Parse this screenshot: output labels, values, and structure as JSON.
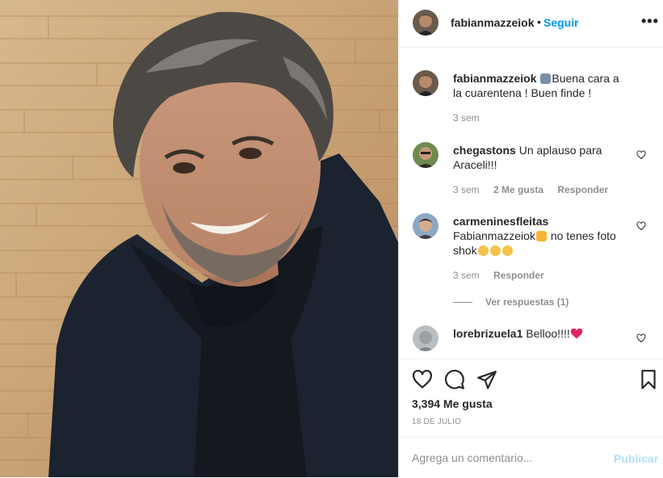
{
  "post": {
    "image_alt": "Fotografía de un hombre sonriente con abrigo oscuro frente a una pared de madera",
    "likes": "3,394 Me gusta",
    "date": "18 DE JULIO"
  },
  "header": {
    "username": "fabianmazzeiok",
    "dot": "•",
    "follow_label": "Seguir",
    "more_icon": "more-options-icon"
  },
  "caption": {
    "username": "fabianmazzeiok",
    "text": "Buena cara a la cuarentena ! Buen finde !",
    "time": "3 sem"
  },
  "comments": [
    {
      "username": "chegastons",
      "text": "Un aplauso para Araceli!!!",
      "time": "3 sem",
      "likes": "2 Me gusta",
      "reply": "Responder"
    },
    {
      "username": "carmeninesfleitas",
      "text_a": "Fabianmazzeiok",
      "text_b": " no tenes foto shok",
      "time": "3 sem",
      "reply": "Responder",
      "view_replies": "Ver respuestas (1)"
    },
    {
      "username": "lorebrizuela1",
      "text": "Belloo!!!!"
    }
  ],
  "actions": {
    "like_icon": "heart-icon",
    "comment_icon": "comment-icon",
    "share_icon": "share-icon",
    "save_icon": "bookmark-icon"
  },
  "add_comment": {
    "placeholder": "Agrega un comentario...",
    "publish_label": "Publicar"
  },
  "colors": {
    "link_blue": "#0095f6",
    "publish_disabled": "#b2dffc",
    "muted": "#8e8e8e",
    "text": "#262626"
  }
}
